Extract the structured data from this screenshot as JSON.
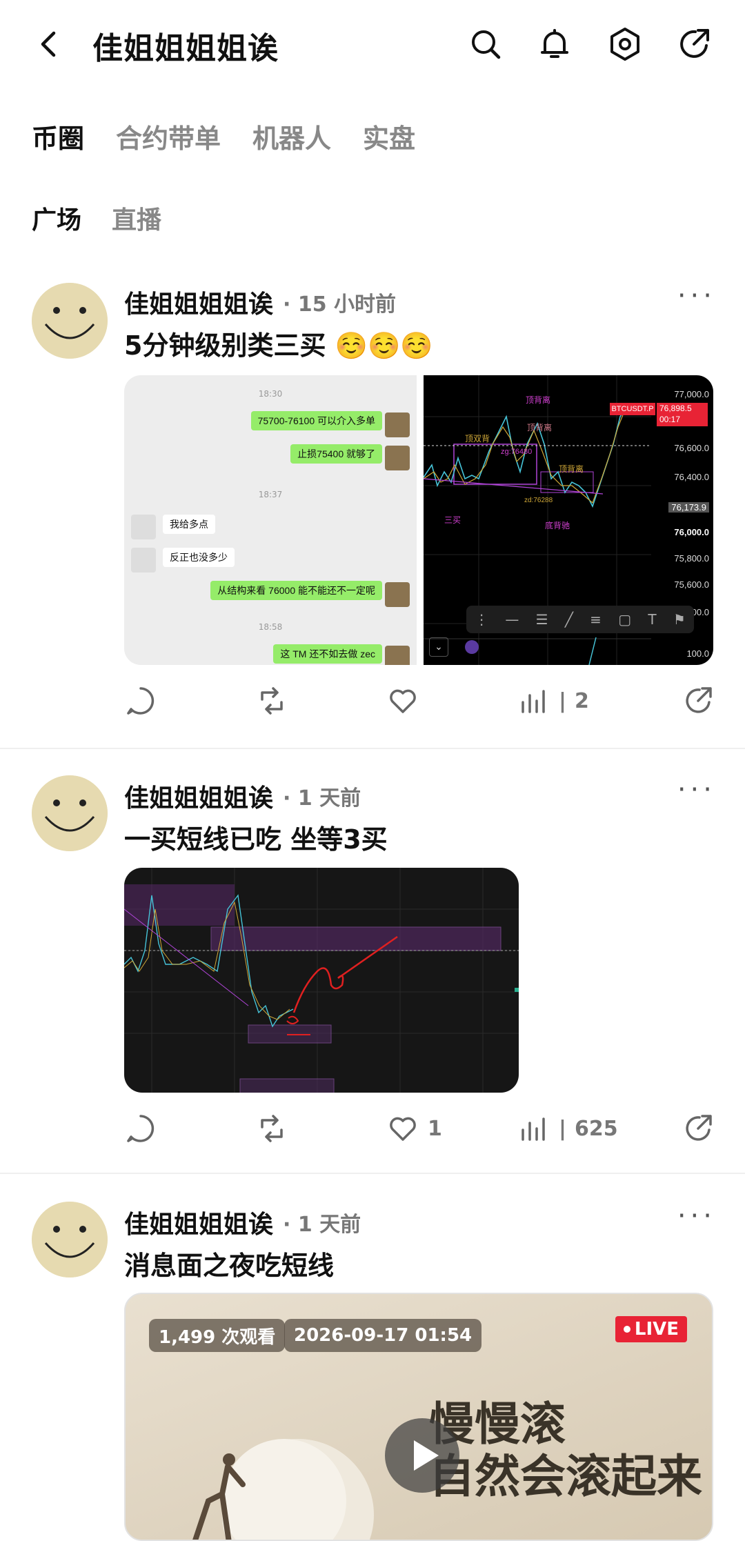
{
  "header": {
    "title": "佳姐姐姐姐诶"
  },
  "tabs_primary": [
    "币圈",
    "合约带单",
    "机器人",
    "实盘"
  ],
  "tabs_secondary": [
    "广场",
    "直播"
  ],
  "posts": [
    {
      "author": "佳姐姐姐姐诶",
      "time": "15 小时前",
      "text": "5分钟级别类三买 ☺️☺️☺️",
      "chat": {
        "time1": "18:30",
        "m1": "75700-76100 可以介入多单",
        "m2": "止损75400 就够了",
        "time2": "18:37",
        "m3": "我给多点",
        "m4": "反正也没多少",
        "m5": "从结构来看 76000 能不能还不一定呢",
        "time3": "18:58",
        "m6": "这 TM 还不如去做 zec"
      },
      "chart": {
        "ticker": "BTCUSDT.P",
        "price": "76,898.5",
        "countdown": "00:17",
        "axis": [
          "77,000.0",
          "76,600.0",
          "76,400.0",
          "76,173.9",
          "76,000.0",
          "75,800.0",
          "75,600.0",
          "400.0",
          "100.0"
        ],
        "labels": [
          "顶背离",
          "顶背离",
          "顶双背",
          "zg:76480",
          "三买",
          "底背驰",
          "顶背离",
          "zd:76288"
        ]
      },
      "views": "2",
      "likes": ""
    },
    {
      "author": "佳姐姐姐姐诶",
      "time": "1 天前",
      "text": "一买短线已吃  坐等3买",
      "views": "625",
      "likes": "1"
    },
    {
      "author": "佳姐姐姐姐诶",
      "time": "1 天前",
      "text": "消息面之夜吃短线",
      "video": {
        "views": "1,499 次观看",
        "date": "2026-09-17 01:54",
        "live": "LIVE",
        "line1": "慢慢滚",
        "line2": "自然会滚起来"
      }
    }
  ]
}
